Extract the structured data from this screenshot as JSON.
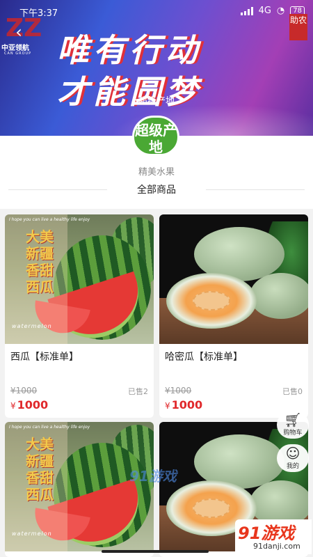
{
  "status_bar": {
    "time": "下午3:37",
    "network": "4G",
    "battery": "78"
  },
  "header": {
    "back_icon": "chevron-left-icon",
    "logo_cn": "中亚领航",
    "logo_en": "CAN GROUP",
    "slogan_line1": "唯有行动",
    "slogan_line2": "才能圆梦",
    "stamp": "助农",
    "shop_name": "超级产地"
  },
  "shop": {
    "badge_text": "超级产地",
    "subtitle": "精美水果",
    "section_title": "全部商品"
  },
  "products": [
    {
      "name": "西瓜【标准单】",
      "original_price": "¥1000",
      "sold": "已售2",
      "currency": "¥",
      "price": "1000",
      "image_tagline": "I hope you can live a healthy life enjoy",
      "image_title": "大美新疆香甜西瓜",
      "image_caption": "watermelon"
    },
    {
      "name": "哈密瓜【标准单】",
      "original_price": "¥1000",
      "sold": "已售0",
      "currency": "¥",
      "price": "1000"
    },
    {
      "image_tagline": "I hope you can live a healthy life enjoy",
      "image_title": "大美新疆香甜西瓜",
      "image_caption": "watermelon"
    },
    {}
  ],
  "float_buttons": {
    "cart": {
      "label": "购物车",
      "icon": "cart-icon"
    },
    "mine": {
      "label": "我的",
      "icon": "user-icon"
    }
  },
  "watermarks": {
    "mid": "91游戏",
    "corner_big": "91游戏",
    "corner_small": "91danji.com"
  },
  "colors": {
    "price": "#e0292c",
    "badge": "#4aa834",
    "stamp": "#c72a2a"
  }
}
